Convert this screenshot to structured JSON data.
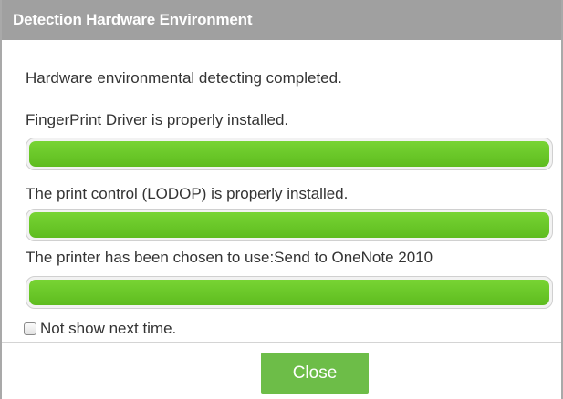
{
  "dialog": {
    "title": "Detection Hardware Environment",
    "status_message": "Hardware environmental detecting completed.",
    "checks": [
      {
        "label": "FingerPrint Driver is properly installed.",
        "progress": 1.0
      },
      {
        "label": "The print control (LODOP) is properly installed.",
        "progress": 1.0
      },
      {
        "label": "The printer has been chosen to use:Send to OneNote 2010",
        "progress": 1.0
      }
    ],
    "not_show_label": "Not show next time.",
    "not_show_checked": false,
    "close_label": "Close"
  },
  "colors": {
    "titlebar": "#a0a0a0",
    "progress_fill": "#6cc52a",
    "close_button": "#6dbd48"
  }
}
